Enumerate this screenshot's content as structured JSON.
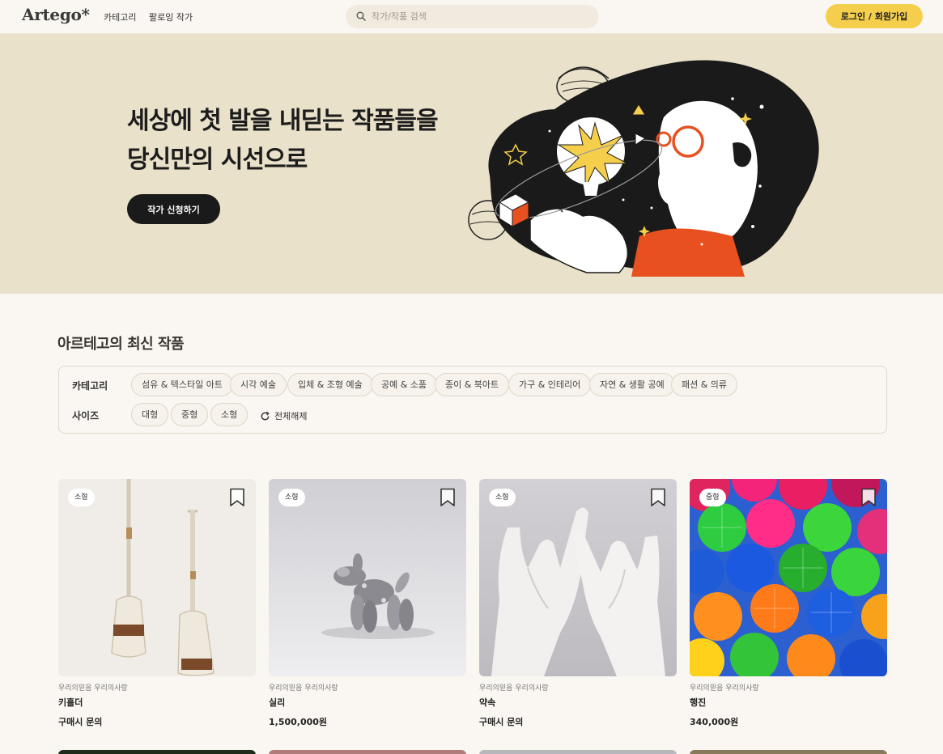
{
  "header": {
    "logo": "Artego*",
    "nav": [
      "카테고리",
      "팔로잉 작가"
    ],
    "search_placeholder": "작가/작품 검색",
    "login_label": "로그인 / 회원가입"
  },
  "hero": {
    "title_line1": "세상에 첫 발을 내딛는 작품들을",
    "title_line2": "당신만의 시선으로",
    "cta_label": "작가 신청하기"
  },
  "section": {
    "title": "아르테고의 최신 작품"
  },
  "filters": {
    "category_label": "카테고리",
    "categories": [
      "섬유 & 텍스타일 아트",
      "시각 예술",
      "입체 & 조형 예술",
      "공예 & 소품",
      "종이 & 북아트",
      "가구 & 인테리어",
      "자연 & 생활 공예",
      "패션 & 의류"
    ],
    "size_label": "사이즈",
    "sizes": [
      "대형",
      "중형",
      "소형"
    ],
    "reset_label": "전체해제"
  },
  "icons": {
    "search": "search-icon",
    "reset": "refresh-icon",
    "bookmark": "bookmark-icon"
  },
  "colors": {
    "accent": "#f5cf4c",
    "hero_bg": "#e9e1c9",
    "page_bg": "#faf7f2"
  },
  "products": [
    {
      "size": "소형",
      "author": "우리의믿음 우리의사랑",
      "name": "키홀더",
      "price": "구매시 문의"
    },
    {
      "size": "소형",
      "author": "우리의믿음 우리의사랑",
      "name": "실리",
      "price": "1,500,000원"
    },
    {
      "size": "소형",
      "author": "우리의믿음 우리의사랑",
      "name": "약속",
      "price": "구매시 문의"
    },
    {
      "size": "중형",
      "author": "우리의믿음 우리의사랑",
      "name": "행진",
      "price": "340,000원"
    }
  ]
}
